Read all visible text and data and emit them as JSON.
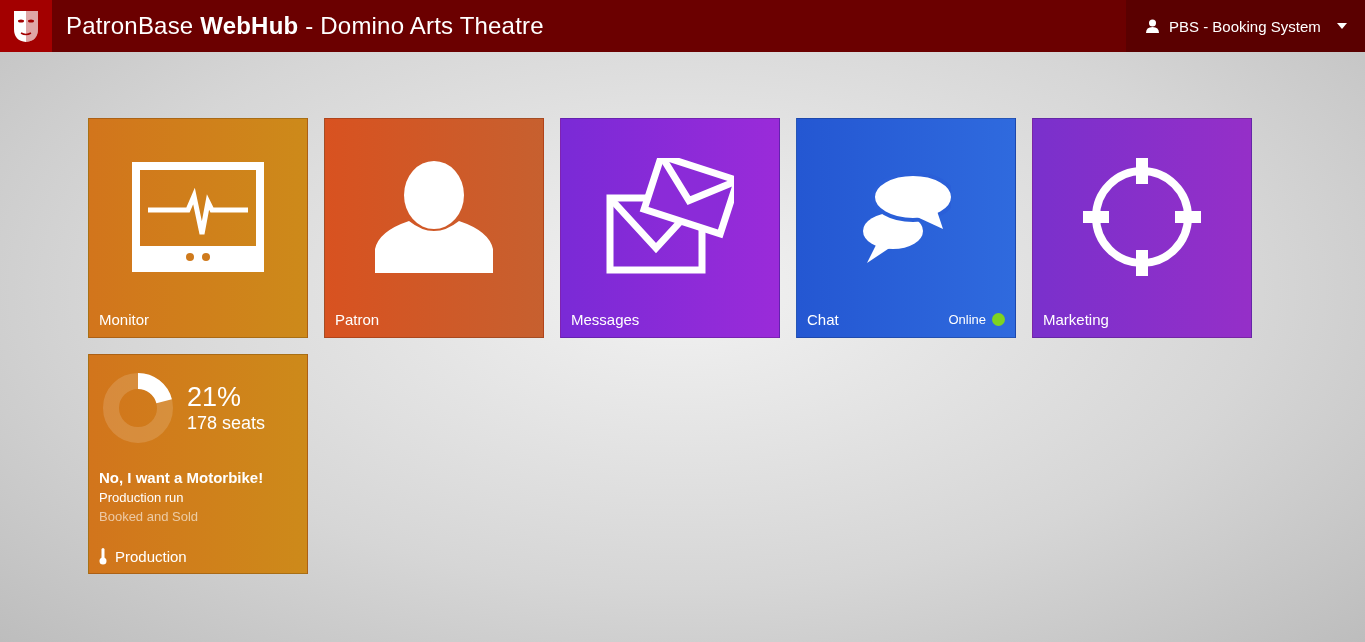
{
  "header": {
    "title_start": "PatronBase ",
    "title_bold": "WebHub",
    "title_end": " - Domino Arts Theatre",
    "user": "PBS - Booking System"
  },
  "tiles": [
    {
      "kind": "monitor",
      "label": "Monitor"
    },
    {
      "kind": "patron",
      "label": "Patron"
    },
    {
      "kind": "messages",
      "label": "Messages"
    },
    {
      "kind": "chat",
      "label": "Chat",
      "status": {
        "label": "Online",
        "online": true
      }
    },
    {
      "kind": "marketing",
      "label": "Marketing"
    }
  ],
  "production": {
    "percent": "21%",
    "seats": "178 seats",
    "name": "No, I want a Motorbike!",
    "run": "Production run",
    "detail": "Booked and Sold",
    "label": "Production"
  }
}
